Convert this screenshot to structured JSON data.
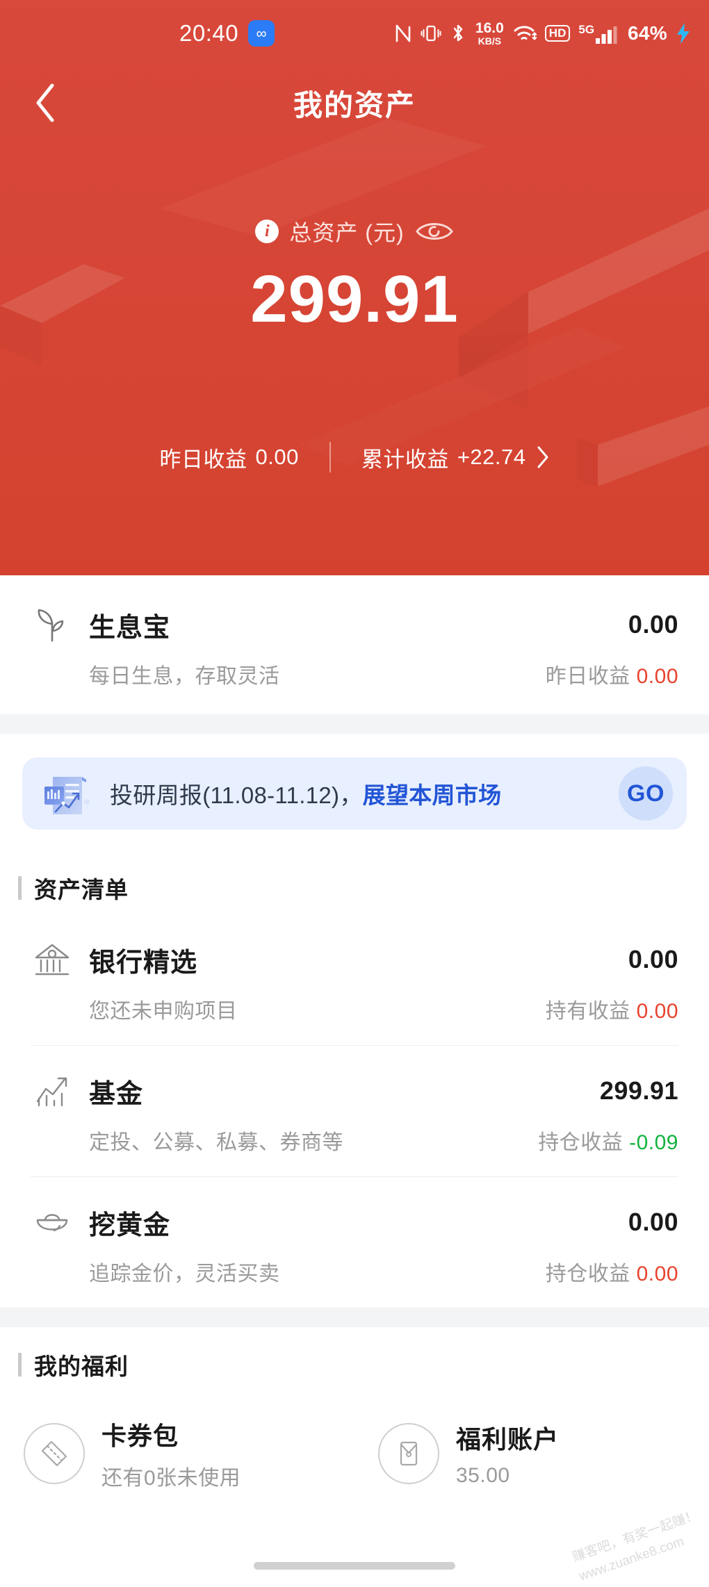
{
  "status_bar": {
    "time": "20:40",
    "app_badge_glyph": "∞",
    "icons": [
      "nfc-icon",
      "vibrate-icon",
      "bluetooth-icon"
    ],
    "network_speed_value": "16.0",
    "network_speed_unit": "KB/S",
    "wifi": "wifi-icon",
    "hd_label": "HD",
    "cellular_label": "5G",
    "battery_percent": "64%",
    "charging": true
  },
  "header": {
    "back_icon": "chevron-left-icon",
    "title": "我的资产",
    "total_label": "总资产 (元)",
    "info_icon_glyph": "i",
    "eye_icon": "eye-visible-icon",
    "total_amount": "299.91",
    "yesterday_profit_label": "昨日收益",
    "yesterday_profit_value": "0.00",
    "cumulative_profit_label": "累计收益",
    "cumulative_profit_value": "+22.74",
    "chevron": "chevron-right-icon",
    "bg_color": "#d9483c"
  },
  "shengxibao": {
    "icon": "sprout-leaf-icon",
    "name": "生息宝",
    "value": "0.00",
    "desc": "每日生息，存取灵活",
    "sub_label": "昨日收益",
    "sub_value": "0.00",
    "sub_color": "#e8432e"
  },
  "banner": {
    "icon": "report-document-chart-icon",
    "text_plain": "投研周报(11.08-11.12)，",
    "text_highlight": "展望本周市场",
    "go_label": "GO",
    "accent_color": "#2255d6",
    "bg_color": "#e8efff"
  },
  "asset_list": {
    "section_title": "资产清单",
    "items": [
      {
        "icon": "bank-building-icon",
        "name": "银行精选",
        "value": "0.00",
        "desc": "您还未申购项目",
        "sub_label": "持有收益",
        "sub_value": "0.00",
        "sub_color": "#e8432e"
      },
      {
        "icon": "trending-chart-icon",
        "name": "基金",
        "value": "299.91",
        "desc": "定投、公募、私募、券商等",
        "sub_label": "持仓收益",
        "sub_value": "-0.09",
        "sub_color": "#12b33f"
      },
      {
        "icon": "gold-ingot-icon",
        "name": "挖黄金",
        "value": "0.00",
        "desc": "追踪金价，灵活买卖",
        "sub_label": "持仓收益",
        "sub_value": "0.00",
        "sub_color": "#e8432e"
      }
    ]
  },
  "benefits": {
    "section_title": "我的福利",
    "items": [
      {
        "icon": "coupon-ticket-icon",
        "title": "卡券包",
        "sub": "还有0张未使用"
      },
      {
        "icon": "red-envelope-icon",
        "title": "福利账户",
        "sub": "35.00"
      }
    ]
  },
  "watermark": {
    "line1": "赚客吧，有奖一起赚！",
    "line2": "www.zuanke8.com"
  }
}
